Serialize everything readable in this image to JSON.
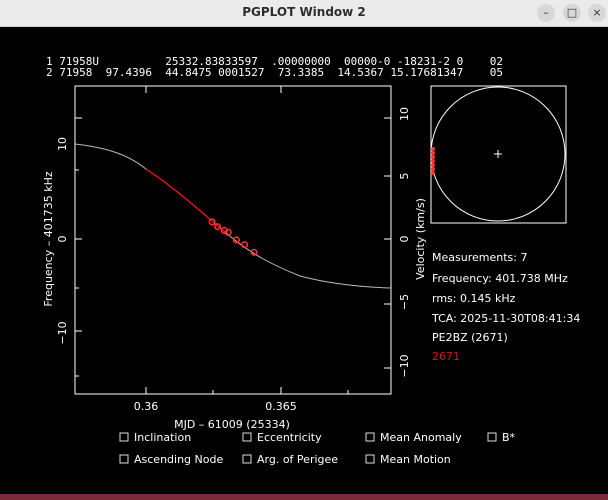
{
  "window": {
    "title": "PGPLOT Window 2",
    "buttons": {
      "minimize": "–",
      "maximize": "□",
      "close": "×"
    }
  },
  "tle": {
    "line1": "1 71958U          25332.83833597  .00000000  00000-0 -18231-2 0    02",
    "line2": "2 71958  97.4396  44.8475 0001527  73.3385  14.5367 15.17681347    05"
  },
  "info": {
    "measurements": "Measurements: 7",
    "frequency": "Frequency: 401.738 MHz",
    "rms": "rms: 0.145 kHz",
    "tca": "TCA: 2025-11-30T08:41:34",
    "observer": "PE2BZ (2671)",
    "site_id": "2671"
  },
  "colors": {
    "background": "#000000",
    "model_curve": "#bbbbbb",
    "fit_segment": "#dd1111",
    "measurements": "#ff3333",
    "site_id": "#dd1111"
  },
  "main_plot": {
    "x_label": "MJD – 61009 (25334)",
    "y_left_label": "Frequency – 401735 kHz",
    "y_right_label": "Velocity (km/s)",
    "x_ticks": [
      "0.36",
      "0.365"
    ],
    "y_left_ticks": [
      "10",
      "0",
      "−10"
    ],
    "y_right_ticks": [
      "10",
      "5",
      "0",
      "−5",
      "−10"
    ],
    "measurements": [
      {
        "x": 0.36245,
        "y": 1.8
      },
      {
        "x": 0.36265,
        "y": 1.3
      },
      {
        "x": 0.3629,
        "y": 0.9
      },
      {
        "x": 0.36305,
        "y": 0.7
      },
      {
        "x": 0.36335,
        "y": -0.1
      },
      {
        "x": 0.36365,
        "y": -0.6
      },
      {
        "x": 0.364,
        "y": -1.4
      }
    ]
  },
  "checkboxes": {
    "row1": [
      "Inclination",
      "Eccentricity",
      "Mean Anomaly",
      "B*"
    ],
    "row2": [
      "Ascending Node",
      "Arg. of Perigee",
      "Mean Motion"
    ]
  }
}
